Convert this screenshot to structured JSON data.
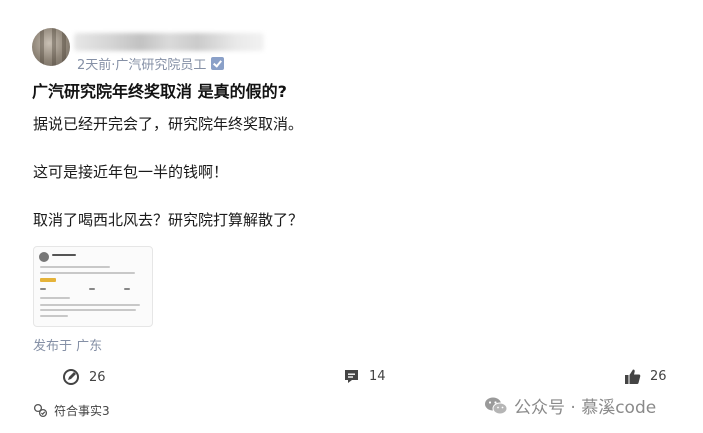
{
  "post": {
    "meta": "2天前·广汽研究院员工",
    "title": "广汽研究院年终奖取消 是真的假的?",
    "paragraphs": [
      "据说已经开完会了，研究院年终奖取消。",
      "这可是接近年包一半的钱啊！",
      "取消了喝西北风去？研究院打算解散了？"
    ],
    "location": "发布于 广东"
  },
  "actions": {
    "comment_count": "26",
    "message_count": "14",
    "like_count": "26"
  },
  "fact_label": "符合事实3",
  "watermark": "公众号 · 慕溪code",
  "colors": {
    "meta": "#8590a6",
    "text": "#1a1a1a",
    "icon": "#444444",
    "watermark": "#8a8a8a"
  }
}
